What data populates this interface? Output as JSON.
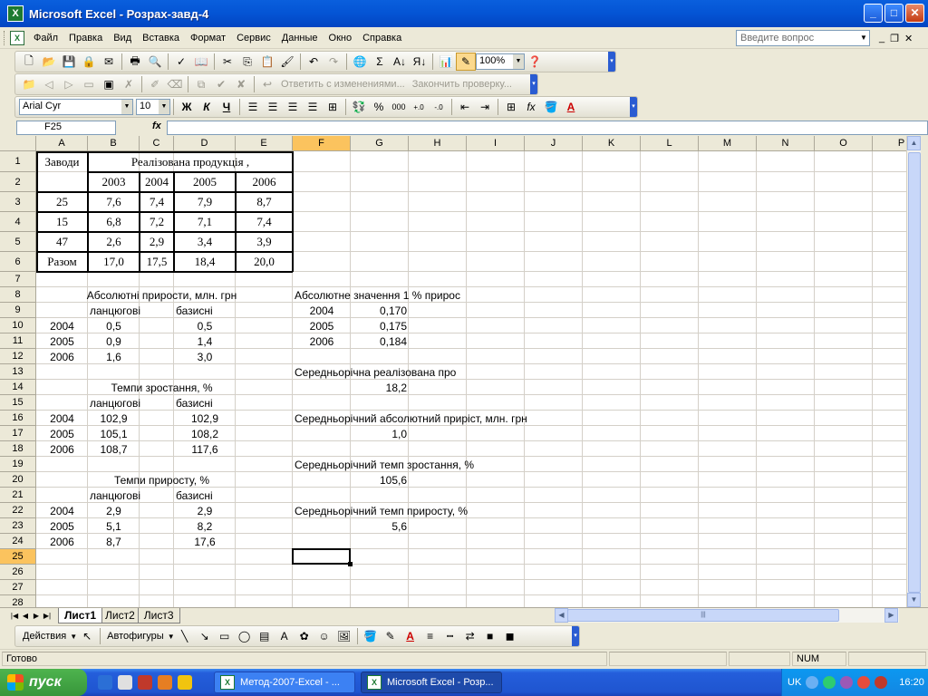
{
  "window": {
    "title": "Microsoft Excel - Розрах-завд-4",
    "icon": "excel-icon",
    "min": "_",
    "max": "□",
    "close": "✕"
  },
  "menu": {
    "items": [
      "Файл",
      "Правка",
      "Вид",
      "Вставка",
      "Формат",
      "Сервис",
      "Данные",
      "Окно",
      "Справка"
    ],
    "help_placeholder": "Введите вопрос",
    "mdi": {
      "min": "_",
      "restore": "❐",
      "close": "✕"
    }
  },
  "toolbar_standard": {
    "zoom": "100%"
  },
  "toolbar_review": {
    "reply": "Ответить с изменениями...",
    "end_review": "Закончить проверку..."
  },
  "toolbar_format": {
    "font": "Arial Cyr",
    "size": "10"
  },
  "formula_bar": {
    "name_box": "F25",
    "fx": "fx",
    "value": ""
  },
  "grid": {
    "columns": [
      "A",
      "B",
      "C",
      "D",
      "E",
      "F",
      "G",
      "H",
      "I",
      "J",
      "K",
      "L",
      "M",
      "N",
      "O",
      "P"
    ],
    "selected_column": "F",
    "rows": [
      "1",
      "2",
      "3",
      "4",
      "5",
      "6",
      "7",
      "8",
      "9",
      "10",
      "11",
      "12",
      "13",
      "14",
      "15",
      "16",
      "17",
      "18",
      "19",
      "20",
      "21",
      "22",
      "23",
      "24",
      "25",
      "26",
      "27",
      "28"
    ],
    "selected_row": "25",
    "active_cell": "F25"
  },
  "table": {
    "header_zavody": "Заводи",
    "header_realizovana": "Реалізована продукція ,",
    "years": [
      "2003",
      "2004",
      "2005",
      "2006"
    ],
    "rows": [
      {
        "label": "25",
        "values": [
          "7,6",
          "7,4",
          "7,9",
          "8,7"
        ]
      },
      {
        "label": "15",
        "values": [
          "6,8",
          "7,2",
          "7,1",
          "7,4"
        ]
      },
      {
        "label": "47",
        "values": [
          "2,6",
          "2,9",
          "3,4",
          "3,9"
        ]
      },
      {
        "label": "Разом",
        "values": [
          "17,0",
          "17,5",
          "18,4",
          "20,0"
        ]
      }
    ]
  },
  "abs_increments": {
    "title": "Абсолютні прирости, млн. грн",
    "chain": "ланцюгові",
    "base": "базисні",
    "rows": [
      {
        "year": "2004",
        "chain": "0,5",
        "base": "0,5"
      },
      {
        "year": "2005",
        "chain": "0,9",
        "base": "1,4"
      },
      {
        "year": "2006",
        "chain": "1,6",
        "base": "3,0"
      }
    ]
  },
  "growth_rates": {
    "title": "Темпи зростання, %",
    "chain": "ланцюгові",
    "base": "базисні",
    "rows": [
      {
        "year": "2004",
        "chain": "102,9",
        "base": "102,9"
      },
      {
        "year": "2005",
        "chain": "105,1",
        "base": "108,2"
      },
      {
        "year": "2006",
        "chain": "108,7",
        "base": "117,6"
      }
    ]
  },
  "increase_rates": {
    "title": "Темпи приросту, %",
    "chain": "ланцюгові",
    "base": "базисні",
    "rows": [
      {
        "year": "2004",
        "chain": "2,9",
        "base": "2,9"
      },
      {
        "year": "2005",
        "chain": "5,1",
        "base": "8,2"
      },
      {
        "year": "2006",
        "chain": "8,7",
        "base": "17,6"
      }
    ]
  },
  "one_percent": {
    "title": "Абсолютне значення 1 % прирос",
    "rows": [
      {
        "year": "2004",
        "value": "0,170"
      },
      {
        "year": "2005",
        "value": "0,175"
      },
      {
        "year": "2006",
        "value": "0,184"
      }
    ]
  },
  "averages": {
    "avg_sales_label": "Середньорічна реалізована про",
    "avg_sales": "18,2",
    "avg_abs_label": "Середньорічний абсолютний приріст, млн. грн",
    "avg_abs": "1,0",
    "avg_growth_label": "Середньорічний темп зростання, %",
    "avg_growth": "105,6",
    "avg_increase_label": "Середньорічний темп приросту, %",
    "avg_increase": "5,6"
  },
  "sheets": {
    "tabs": [
      "Лист1",
      "Лист2",
      "Лист3"
    ],
    "active": "Лист1"
  },
  "drawing": {
    "actions": "Действия",
    "autoshapes": "Автофигуры"
  },
  "status": {
    "left": "Готово",
    "num": "NUM"
  },
  "taskbar": {
    "start": "пуск",
    "tasks": [
      "Метод-2007-Excel - ...",
      "Microsoft Excel - Розр..."
    ],
    "lang": "UK",
    "clock": "16:20"
  }
}
